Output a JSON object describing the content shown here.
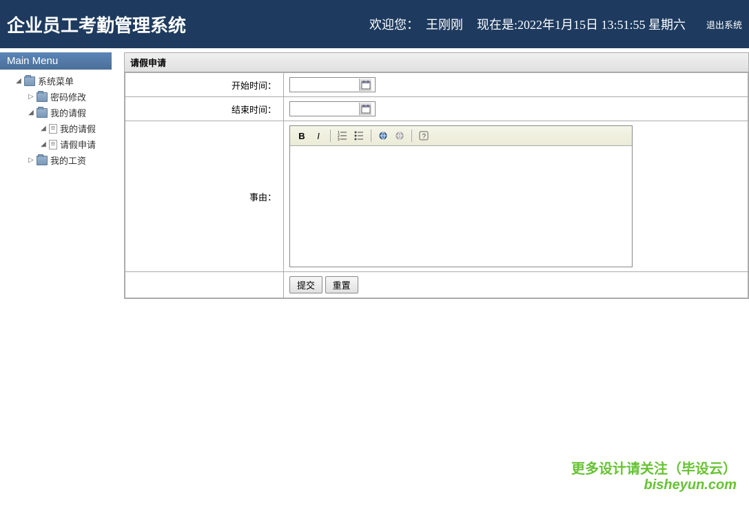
{
  "header": {
    "title": "企业员工考勤管理系统",
    "welcome_label": "欢迎您：",
    "username": "王刚刚",
    "datetime_prefix": "现在是:",
    "datetime": "2022年1月15日 13:51:55 星期六",
    "logout": "退出系统"
  },
  "sidebar": {
    "title": "Main Menu",
    "tree": {
      "root": "系统菜单",
      "items": [
        {
          "label": "密码修改",
          "type": "folder",
          "expander": "▷"
        },
        {
          "label": "我的请假",
          "type": "folder",
          "expander": "◢",
          "children": [
            {
              "label": "我的请假",
              "type": "file",
              "expander": "◢"
            },
            {
              "label": "请假申请",
              "type": "file",
              "expander": "◢"
            }
          ]
        },
        {
          "label": "我的工资",
          "type": "folder",
          "expander": "▷"
        }
      ]
    }
  },
  "content": {
    "panel_title": "请假申请",
    "form": {
      "start_time_label": "开始时间：",
      "end_time_label": "结束时间：",
      "reason_label": "事由：",
      "start_time_value": "",
      "end_time_value": "",
      "reason_value": "",
      "submit": "提交",
      "reset": "重置"
    },
    "editor_icons": {
      "bold": "B",
      "italic": "I"
    }
  },
  "watermark": {
    "line1": "更多设计请关注（毕设云）",
    "line2": "bisheyun.com"
  }
}
